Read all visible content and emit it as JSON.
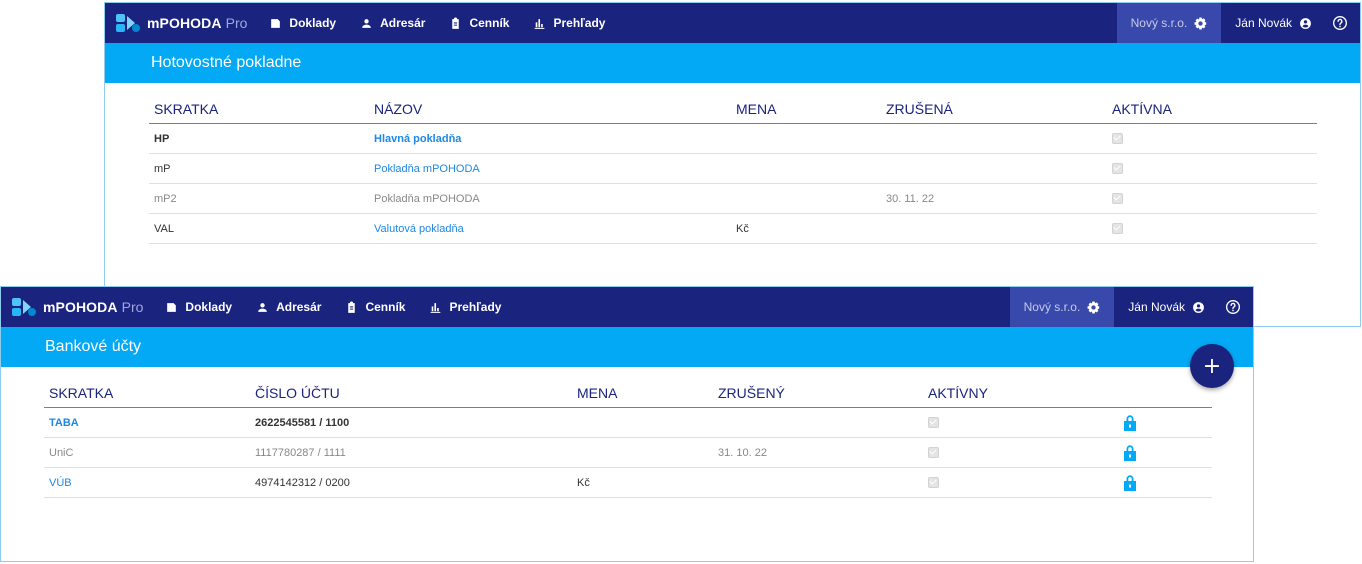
{
  "app": {
    "name": "mPOHODA",
    "edition": "Pro"
  },
  "nav": {
    "items": [
      "Doklady",
      "Adresár",
      "Cenník",
      "Prehľady"
    ]
  },
  "company": "Nový s.r.o.",
  "user": "Ján Novák",
  "colors": {
    "navbar": "#1a237e",
    "titlebar": "#03a9f4",
    "company_bg": "#3949ab",
    "link": "#1e88e5"
  },
  "icons": [
    "logo-icon",
    "documents-icon",
    "person-icon",
    "clipboard-icon",
    "bar-chart-icon",
    "gear-icon",
    "account-circle-icon",
    "help-icon",
    "lock-icon",
    "plus-icon"
  ],
  "cash_registers": {
    "title": "Hotovostné pokladne",
    "headers": [
      "SKRATKA",
      "NÁZOV",
      "MENA",
      "ZRUŠENÁ",
      "AKTÍVNA"
    ],
    "rows": [
      {
        "code": "HP",
        "name": "Hlavná pokladňa",
        "currency": "",
        "cancelled": "",
        "active": true
      },
      {
        "code": "mP",
        "name": "Pokladňa mPOHODA",
        "currency": "",
        "cancelled": "",
        "active": true
      },
      {
        "code": "mP2",
        "name": "Pokladňa mPOHODA",
        "currency": "",
        "cancelled": "30. 11. 22",
        "active": true
      },
      {
        "code": "VAL",
        "name": "Valutová pokladňa",
        "currency": "Kč",
        "cancelled": "",
        "active": true
      }
    ]
  },
  "bank_accounts": {
    "title": "Bankové účty",
    "add_label": "+",
    "headers": [
      "SKRATKA",
      "ČÍSLO ÚČTU",
      "MENA",
      "ZRUŠENÝ",
      "AKTÍVNY"
    ],
    "rows": [
      {
        "code": "TABA",
        "number": "2622545581 / 1100",
        "currency": "",
        "cancelled": "",
        "active": true,
        "locked": true
      },
      {
        "code": "UniC",
        "number": "1117780287 / 1111",
        "currency": "",
        "cancelled": "31. 10. 22",
        "active": true,
        "locked": true
      },
      {
        "code": "VÚB",
        "number": "4974142312 / 0200",
        "currency": "Kč",
        "cancelled": "",
        "active": true,
        "locked": true
      }
    ]
  }
}
